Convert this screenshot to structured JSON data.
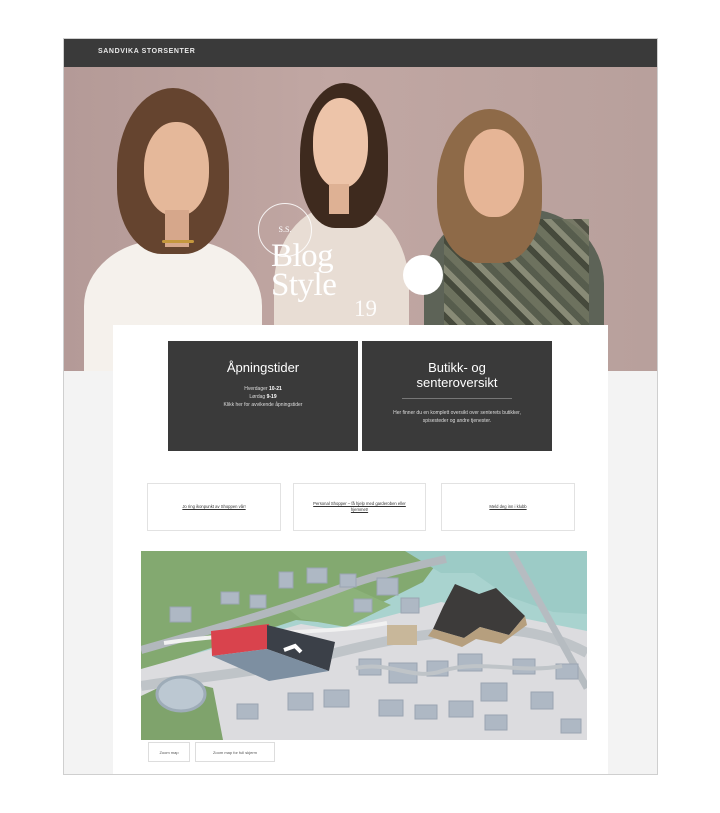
{
  "header": {
    "brand": "SANDVIKA STORSENTER"
  },
  "hero": {
    "logo_badge_text": "S.S.",
    "blog_text": "Blog Style",
    "blog_number": "19",
    "round_badge_text": ""
  },
  "cards": {
    "opening_hours": {
      "title": "Åpningstider",
      "weekday_label": "Hverdager",
      "weekday_hours": "10-21",
      "saturday_label": "Lørdag",
      "saturday_hours": "9-19",
      "note": "Klikk her for avvikende åpningstider"
    },
    "overview": {
      "title": "Butikk- og senteroversikt",
      "description": "Her finner du en komplett oversikt over senterets butikker, spisesteder og andre tjenester."
    }
  },
  "links": [
    "Jo ring ikonpunkt av Shoppen vår!",
    "Personal Shopper – få hjelp med garderoben eller hjemmet!",
    "Meld deg inn i klubb"
  ],
  "map_buttons": {
    "zoom_map": "Zoom map",
    "zoom_map_full": "Zoom map for full skjerm"
  },
  "colors": {
    "topbar": "#3a3a3a",
    "card": "#3a3a3a",
    "highlight_building": "#d9434d",
    "map_water": "#a9d3cf",
    "map_park": "#7fa36c"
  }
}
